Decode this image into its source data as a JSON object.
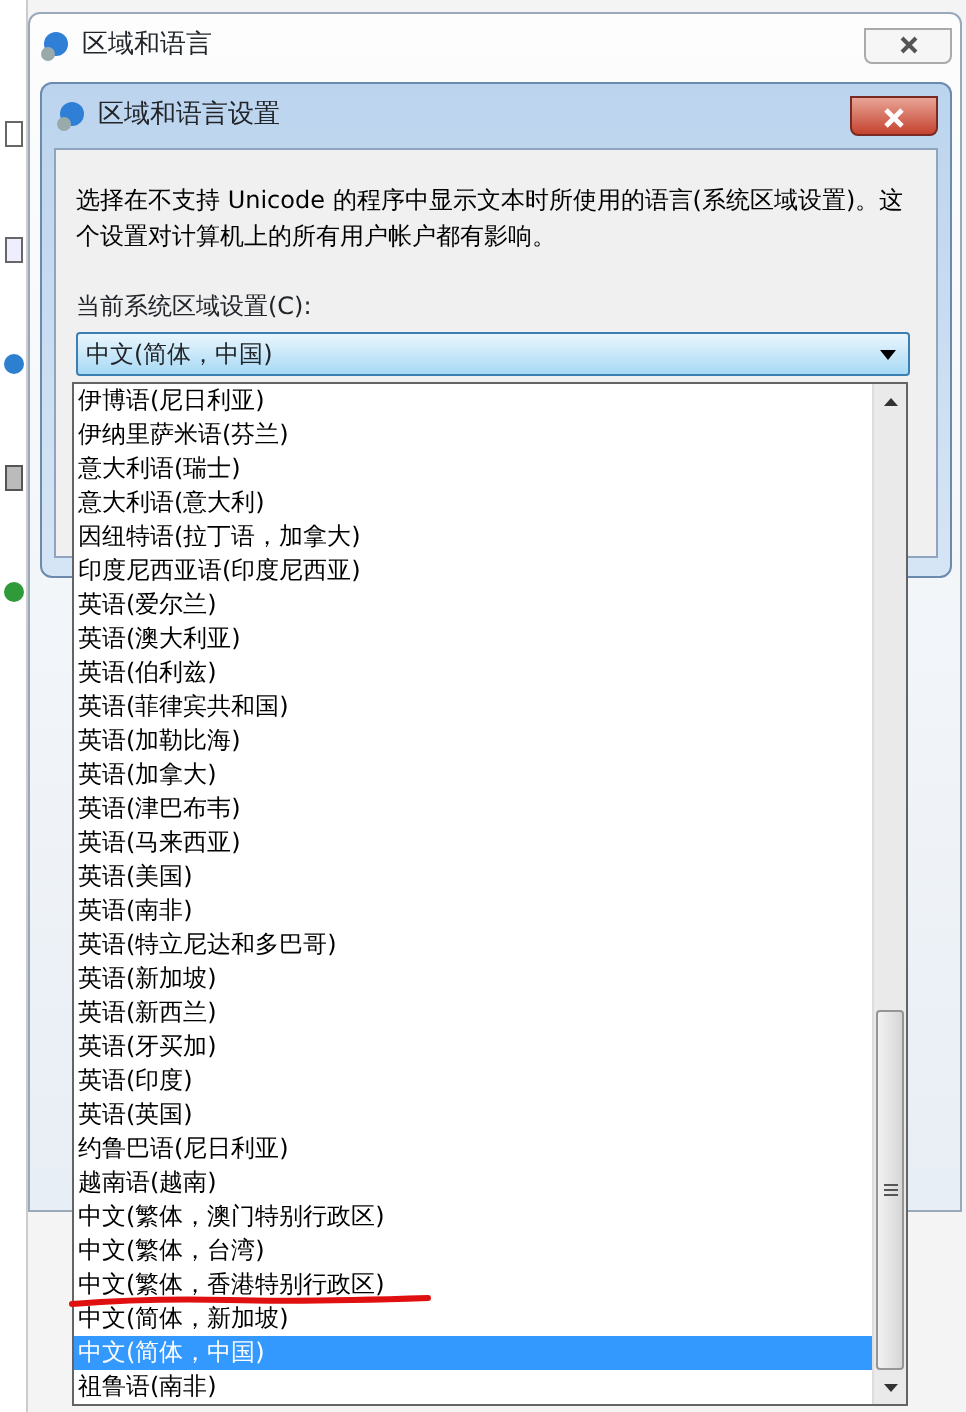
{
  "outer_window": {
    "title": "区域和语言"
  },
  "dialog": {
    "title": "区域和语言设置",
    "description": "选择在不支持 Unicode 的程序中显示文本时所使用的语言(系统区域设置)。这个设置对计算机上的所有用户帐户都有影响。",
    "field_label": "当前系统区域设置(C):",
    "select": {
      "value": "中文(简体，中国)",
      "expanded": true
    }
  },
  "options": [
    {
      "label": "伊博语(尼日利亚)",
      "selected": false,
      "annotated": false
    },
    {
      "label": "伊纳里萨米语(芬兰)",
      "selected": false,
      "annotated": false
    },
    {
      "label": "意大利语(瑞士)",
      "selected": false,
      "annotated": false
    },
    {
      "label": "意大利语(意大利)",
      "selected": false,
      "annotated": false
    },
    {
      "label": "因纽特语(拉丁语，加拿大)",
      "selected": false,
      "annotated": false
    },
    {
      "label": "印度尼西亚语(印度尼西亚)",
      "selected": false,
      "annotated": false
    },
    {
      "label": "英语(爱尔兰)",
      "selected": false,
      "annotated": false
    },
    {
      "label": "英语(澳大利亚)",
      "selected": false,
      "annotated": false
    },
    {
      "label": "英语(伯利兹)",
      "selected": false,
      "annotated": false
    },
    {
      "label": "英语(菲律宾共和国)",
      "selected": false,
      "annotated": false
    },
    {
      "label": "英语(加勒比海)",
      "selected": false,
      "annotated": false
    },
    {
      "label": "英语(加拿大)",
      "selected": false,
      "annotated": false
    },
    {
      "label": "英语(津巴布韦)",
      "selected": false,
      "annotated": false
    },
    {
      "label": "英语(马来西亚)",
      "selected": false,
      "annotated": false
    },
    {
      "label": "英语(美国)",
      "selected": false,
      "annotated": false
    },
    {
      "label": "英语(南非)",
      "selected": false,
      "annotated": false
    },
    {
      "label": "英语(特立尼达和多巴哥)",
      "selected": false,
      "annotated": false
    },
    {
      "label": "英语(新加坡)",
      "selected": false,
      "annotated": false
    },
    {
      "label": "英语(新西兰)",
      "selected": false,
      "annotated": false
    },
    {
      "label": "英语(牙买加)",
      "selected": false,
      "annotated": false
    },
    {
      "label": "英语(印度)",
      "selected": false,
      "annotated": false
    },
    {
      "label": "英语(英国)",
      "selected": false,
      "annotated": false
    },
    {
      "label": "约鲁巴语(尼日利亚)",
      "selected": false,
      "annotated": false
    },
    {
      "label": "越南语(越南)",
      "selected": false,
      "annotated": false
    },
    {
      "label": "中文(繁体，澳门特别行政区)",
      "selected": false,
      "annotated": false
    },
    {
      "label": "中文(繁体，台湾)",
      "selected": false,
      "annotated": false
    },
    {
      "label": "中文(繁体，香港特别行政区)",
      "selected": false,
      "annotated": true
    },
    {
      "label": "中文(简体，新加坡)",
      "selected": false,
      "annotated": false
    },
    {
      "label": "中文(简体，中国)",
      "selected": true,
      "annotated": false
    },
    {
      "label": "祖鲁语(南非)",
      "selected": false,
      "annotated": false
    }
  ]
}
